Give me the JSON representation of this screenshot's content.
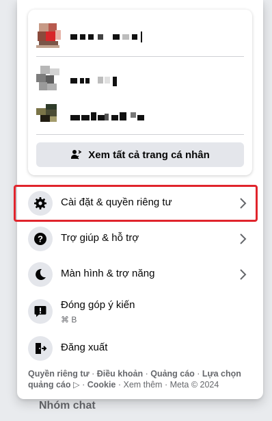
{
  "profiles_card": {
    "see_all_label": "Xem tất cả trang cá nhân",
    "see_all_icon": "profiles-switch-icon"
  },
  "menu": {
    "items": [
      {
        "label": "Cài đặt & quyền riêng tư",
        "icon": "gear-icon",
        "has_chevron": true,
        "highlighted": true
      },
      {
        "label": "Trợ giúp & hỗ trợ",
        "icon": "help-icon",
        "has_chevron": true
      },
      {
        "label": "Màn hình & trợ năng",
        "icon": "moon-icon",
        "has_chevron": true
      },
      {
        "label": "Đóng góp ý kiến",
        "sub": "⌘ B",
        "icon": "feedback-icon",
        "has_chevron": false
      },
      {
        "label": "Đăng xuất",
        "icon": "logout-icon",
        "has_chevron": false
      }
    ]
  },
  "footer": {
    "privacy": "Quyền riêng tư",
    "terms": "Điều khoản",
    "ads": "Quảng cáo",
    "ad_choices": "Lựa chọn quảng cáo ▷",
    "cookie": "Cookie",
    "more": "Xem thêm",
    "meta": "Meta © 2024",
    "sep": " · "
  },
  "background": {
    "nhom_chat": "Nhóm chat"
  },
  "colors": {
    "highlight": "#e0242c",
    "button_bg": "#e4e6eb",
    "text": "#050505",
    "secondary": "#65676b"
  }
}
